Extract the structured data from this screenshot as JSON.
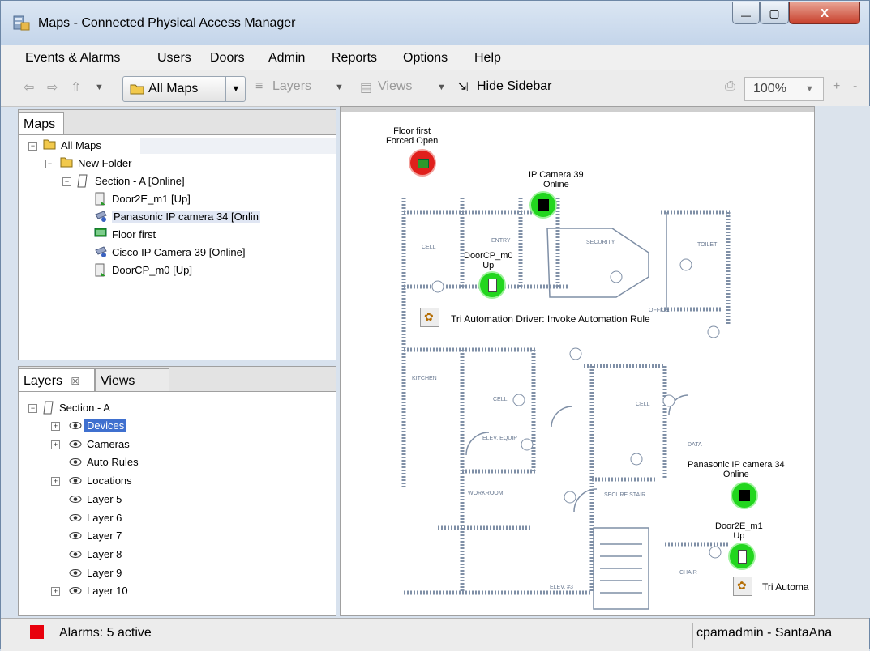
{
  "window": {
    "title": "Maps - Connected Physical Access Manager",
    "controls": {
      "minimize": "—",
      "maximize": "▢",
      "close": "X"
    }
  },
  "menu": [
    "Events & Alarms",
    "Users",
    "Doors",
    "Admin",
    "Reports",
    "Options",
    "Help"
  ],
  "toolbar": {
    "all_maps": "All Maps",
    "layers": "Layers",
    "views": "Views",
    "hide_sidebar": "Hide Sidebar",
    "zoom": "100%",
    "zoom_in": "+",
    "zoom_out": "-"
  },
  "maps_panel": {
    "tab": "Maps",
    "items": [
      {
        "label": "All Maps",
        "depth": 0,
        "icon": "folder-icon",
        "expander": "minus"
      },
      {
        "label": "New Folder",
        "depth": 1,
        "icon": "folder-icon",
        "expander": "minus"
      },
      {
        "label": "Section - A [Online]",
        "depth": 2,
        "icon": "map-page-icon",
        "expander": "minus"
      },
      {
        "label": "Door2E_m1 [Up]",
        "depth": 3,
        "icon": "door-icon",
        "expander": ""
      },
      {
        "label": "Panasonic IP camera 34 [Onlin",
        "depth": 3,
        "icon": "camera-icon",
        "expander": "",
        "selected": true
      },
      {
        "label": "Floor first",
        "depth": 3,
        "icon": "floor-icon",
        "expander": ""
      },
      {
        "label": "Cisco IP Camera 39 [Online]",
        "depth": 3,
        "icon": "camera-icon",
        "expander": ""
      },
      {
        "label": "DoorCP_m0 [Up]",
        "depth": 3,
        "icon": "door-icon",
        "expander": ""
      }
    ]
  },
  "layers_panel": {
    "tab_layers": "Layers",
    "tab_close": "☒",
    "tab_views": "Views",
    "root": "Section - A",
    "items": [
      {
        "label": "Devices",
        "expander": "plus",
        "selected": true
      },
      {
        "label": "Cameras",
        "expander": "plus"
      },
      {
        "label": "Auto Rules",
        "expander": ""
      },
      {
        "label": "Locations",
        "expander": "plus"
      },
      {
        "label": "Layer 5",
        "expander": ""
      },
      {
        "label": "Layer 6",
        "expander": ""
      },
      {
        "label": "Layer 7",
        "expander": ""
      },
      {
        "label": "Layer 8",
        "expander": ""
      },
      {
        "label": "Layer 9",
        "expander": ""
      },
      {
        "label": "Layer 10",
        "expander": "plus"
      }
    ]
  },
  "map": {
    "floor_label_1": "Floor first",
    "floor_label_2": "Forced Open",
    "cam39_label_1": "IP Camera 39",
    "cam39_label_2": "Online",
    "doorcp_label_1": "DoorCP_m0",
    "doorcp_label_2": "Up",
    "auto_rule_label": "Tri Automation Driver: Invoke Automation Rule",
    "cam34_label_1": "Panasonic IP camera 34",
    "cam34_label_2": "Online",
    "door2e_label_1": "Door2E_m1",
    "door2e_label_2": "Up",
    "auto_rule_label_2": "Tri Automa",
    "rooms": {
      "cell": "CELL",
      "entry": "ENTRY",
      "security": "SECURITY",
      "toilet": "TOILET",
      "office": "OFFICE",
      "kitchen": "KITCHEN",
      "cell2": "CELL",
      "cell3": "CELL",
      "elev_equip": "ELEV. EQUIP",
      "data": "DATA",
      "workroom": "WORKROOM",
      "secure_stair": "SECURE STAIR",
      "elev": "ELEV. #3",
      "chair": "CHAIR"
    },
    "status_colors": {
      "alarm": "#e0201c",
      "online": "#22d61e"
    }
  },
  "status": {
    "alarms": "Alarms: 5 active",
    "user": "cpamadmin - SantaAna",
    "alarm_color": "#e8000c"
  }
}
